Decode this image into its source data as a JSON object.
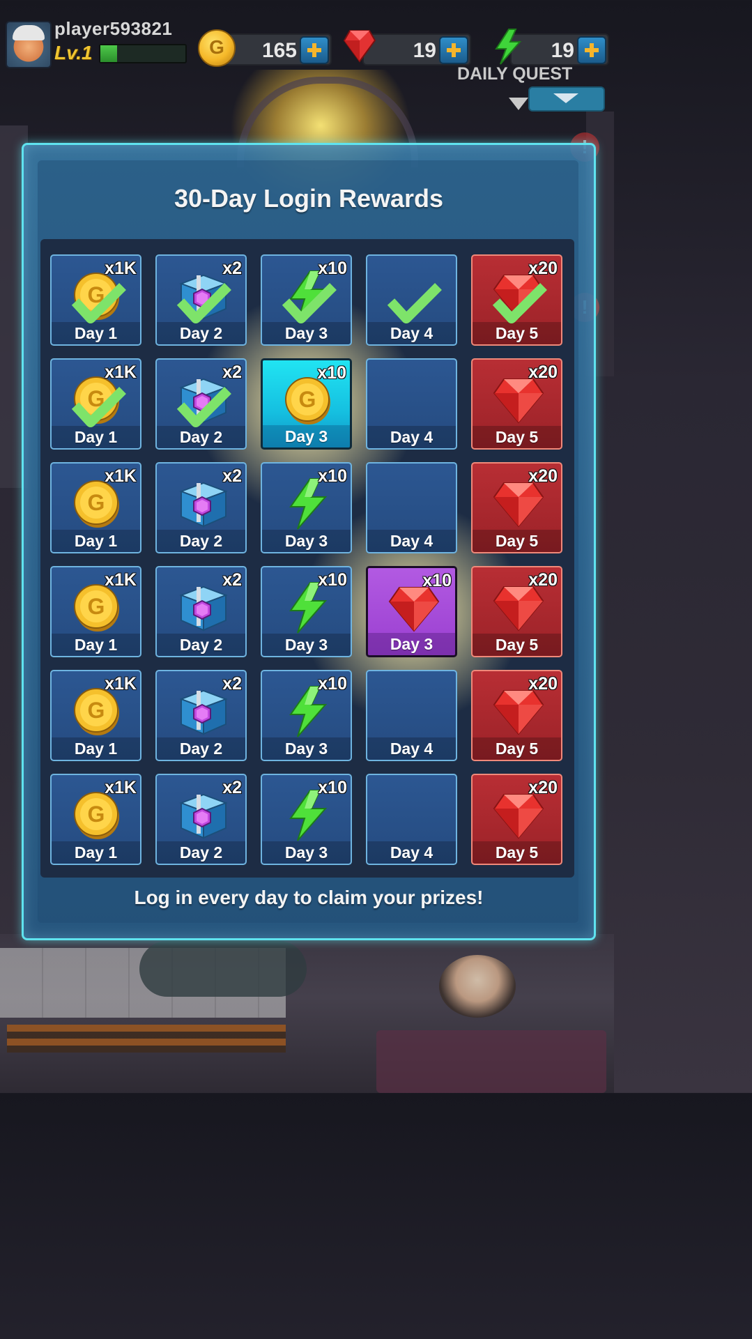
{
  "hud": {
    "player_name": "player593821",
    "level": "Lv.1",
    "xp_progress": 0.2,
    "coins": "165",
    "gems": "19",
    "energy": "19",
    "daily_quest": "DAILY QUEST"
  },
  "modal": {
    "title": "30-Day Login Rewards",
    "footer": "Log in every day to claim your prizes!",
    "rows": [
      [
        {
          "day": "Day 1",
          "qty": "x1K",
          "icon": "coin-icon",
          "claimed": true,
          "style": "normal"
        },
        {
          "day": "Day 2",
          "qty": "x2",
          "icon": "chest-icon",
          "claimed": true,
          "style": "normal"
        },
        {
          "day": "Day 3",
          "qty": "x10",
          "icon": "bolt-icon",
          "claimed": true,
          "style": "normal"
        },
        {
          "day": "Day 4",
          "qty": "",
          "icon": "",
          "claimed": true,
          "style": "normal"
        },
        {
          "day": "Day 5",
          "qty": "x20",
          "icon": "gem-icon",
          "claimed": true,
          "style": "red"
        }
      ],
      [
        {
          "day": "Day 1",
          "qty": "x1K",
          "icon": "coin-icon",
          "claimed": true,
          "style": "normal"
        },
        {
          "day": "Day 2",
          "qty": "x2",
          "icon": "chest-icon",
          "claimed": true,
          "style": "normal"
        },
        {
          "day": "Day 3",
          "qty": "x10",
          "icon": "coin-icon",
          "claimed": false,
          "style": "cyan"
        },
        {
          "day": "Day 4",
          "qty": "",
          "icon": "",
          "claimed": false,
          "style": "normal"
        },
        {
          "day": "Day 5",
          "qty": "x20",
          "icon": "gem-icon",
          "claimed": false,
          "style": "red"
        }
      ],
      [
        {
          "day": "Day 1",
          "qty": "x1K",
          "icon": "coin-icon",
          "claimed": false,
          "style": "normal"
        },
        {
          "day": "Day 2",
          "qty": "x2",
          "icon": "chest-icon",
          "claimed": false,
          "style": "normal"
        },
        {
          "day": "Day 3",
          "qty": "x10",
          "icon": "bolt-icon",
          "claimed": false,
          "style": "normal"
        },
        {
          "day": "Day 4",
          "qty": "",
          "icon": "",
          "claimed": false,
          "style": "normal"
        },
        {
          "day": "Day 5",
          "qty": "x20",
          "icon": "gem-icon",
          "claimed": false,
          "style": "red"
        }
      ],
      [
        {
          "day": "Day 1",
          "qty": "x1K",
          "icon": "coin-icon",
          "claimed": false,
          "style": "normal"
        },
        {
          "day": "Day 2",
          "qty": "x2",
          "icon": "chest-icon",
          "claimed": false,
          "style": "normal"
        },
        {
          "day": "Day 3",
          "qty": "x10",
          "icon": "bolt-icon",
          "claimed": false,
          "style": "normal"
        },
        {
          "day": "Day 3",
          "qty": "x10",
          "icon": "gem-icon",
          "claimed": false,
          "style": "purple"
        },
        {
          "day": "Day 5",
          "qty": "x20",
          "icon": "gem-icon",
          "claimed": false,
          "style": "red"
        }
      ],
      [
        {
          "day": "Day 1",
          "qty": "x1K",
          "icon": "coin-icon",
          "claimed": false,
          "style": "normal"
        },
        {
          "day": "Day 2",
          "qty": "x2",
          "icon": "chest-icon",
          "claimed": false,
          "style": "normal"
        },
        {
          "day": "Day 3",
          "qty": "x10",
          "icon": "bolt-icon",
          "claimed": false,
          "style": "normal"
        },
        {
          "day": "Day 4",
          "qty": "",
          "icon": "",
          "claimed": false,
          "style": "normal"
        },
        {
          "day": "Day 5",
          "qty": "x20",
          "icon": "gem-icon",
          "claimed": false,
          "style": "red"
        }
      ],
      [
        {
          "day": "Day 1",
          "qty": "x1K",
          "icon": "coin-icon",
          "claimed": false,
          "style": "normal"
        },
        {
          "day": "Day 2",
          "qty": "x2",
          "icon": "chest-icon",
          "claimed": false,
          "style": "normal"
        },
        {
          "day": "Day 3",
          "qty": "x10",
          "icon": "bolt-icon",
          "claimed": false,
          "style": "normal"
        },
        {
          "day": "Day 4",
          "qty": "",
          "icon": "",
          "claimed": false,
          "style": "normal"
        },
        {
          "day": "Day 5",
          "qty": "x20",
          "icon": "gem-icon",
          "claimed": false,
          "style": "red"
        }
      ]
    ]
  },
  "colors": {
    "accent_cyan": "#5fe3ef",
    "claimed_check": "#7ee36a",
    "gold": "#f0c531",
    "highlight_purple": "#9a3fd0"
  }
}
